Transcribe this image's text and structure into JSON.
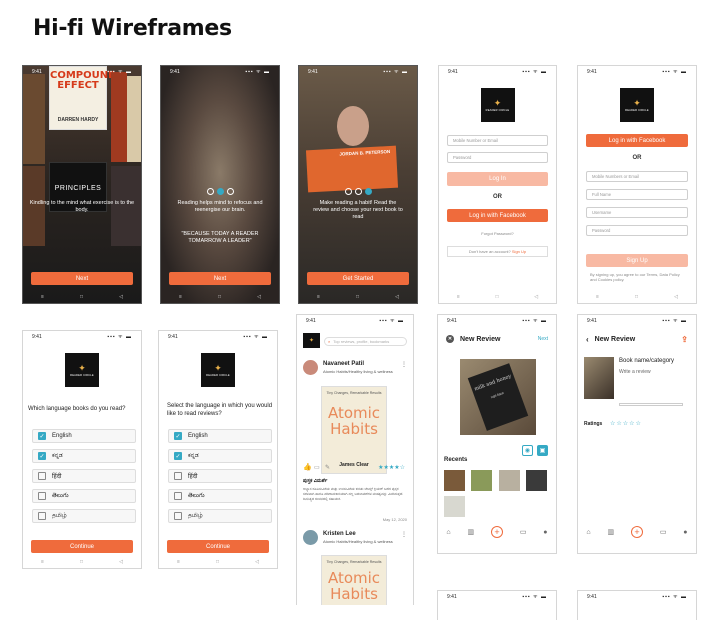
{
  "page_title": "Hi-fi Wireframes",
  "status_time": "9:41",
  "status_icons": "▪▪▪ ᯤ ▬",
  "nav_icons": [
    "≡",
    "□",
    "◁"
  ],
  "screens": {
    "onboard1": {
      "text": "Kindling to the mind what exercise is to the body.",
      "button": "Next",
      "book_title_1": "COMPOUND EFFECT",
      "book_author_1": "DARREN HARDY",
      "book_title_2": "PRINCIPLES"
    },
    "onboard2": {
      "text": "Reading helps mind to refocus and reenergise our brain.",
      "quote": "\"BECAUSE TODAY A READER TOMARROW A LEADER\"",
      "button": "Next"
    },
    "onboard3": {
      "text": "Make reading a habit! Read the review and choose your next book to read",
      "book_author": "JORDAN B. PETERSON",
      "button": "Get Started"
    },
    "login": {
      "logo_text": "READER CIRCLE",
      "mobile_placeholder": "Mobile Number or Email",
      "password_placeholder": "Password",
      "login_button": "Log In",
      "or": "OR",
      "facebook_button": "Log in with Facebook",
      "forgot": "Forgot Password?",
      "no_account": "Don't have an account?",
      "signup_link": "Sign Up"
    },
    "signup": {
      "logo_text": "READER CIRCLE",
      "facebook_button": "Log in with Facebook",
      "or": "OR",
      "mobile_placeholder": "Mobile Numbers or Email",
      "fullname_placeholder": "Full Name",
      "username_placeholder": "Username",
      "password_placeholder": "Password",
      "signup_button": "Sign Up",
      "terms": "By signing up, you agree to our Terms, Data Policy and Cookies policy."
    },
    "lang_read": {
      "logo_text": "READER CIRCLE",
      "question": "Which language books do you read?",
      "options": [
        {
          "label": "English",
          "checked": true
        },
        {
          "label": "ಕನ್ನಡ",
          "checked": true
        },
        {
          "label": "हिंदी",
          "checked": false
        },
        {
          "label": "తెలుగు",
          "checked": false
        },
        {
          "label": "தமிழ்",
          "checked": false
        }
      ],
      "button": "Continue"
    },
    "lang_review": {
      "logo_text": "READER CIRCLE",
      "question": "Select the language in which you would like to read reviews?",
      "options": [
        {
          "label": "English",
          "checked": true
        },
        {
          "label": "ಕನ್ನಡ",
          "checked": true
        },
        {
          "label": "हिंदी",
          "checked": false
        },
        {
          "label": "తెలుగు",
          "checked": false
        },
        {
          "label": "தமிழ்",
          "checked": false
        }
      ],
      "button": "Continue"
    },
    "feed": {
      "search_placeholder": "Top reviews, profile, bookmarks",
      "post1": {
        "name": "Navaneet Patil",
        "sub": "Atomic Habits/Healthy living & wellness",
        "book_line": "Tiny Changes, Remarkable Results",
        "book_title": "Atomic Habits",
        "book_author": "James Clear",
        "stars": "★★★★☆",
        "kn_title": "ಪುಸ್ತಕ ವಿಮರ್ಶೆ",
        "kn_body": "ಅಭ್ಯಾಸ ರೂಪಿಸುವಿಕೆಯ ಮತ್ತು ಉಳಿಸುವಿಕೆಯ ಕುರಿತು ಜೇಮ್ಸ್ ಕ್ಲಿಯರ್ ಬರೆದ ಪುಸ್ತಕ ಸರಳವಾಗಿ ಹಾಗೂ ಪರಿಣಾಮಕಾರಿಯಾಗಿ ಸಣ್ಣ ಬದಲಾವಣೆಗಳ ಮಹತ್ವವನ್ನು ವಿವರಿಸುತ್ತದೆ. ದಿನನಿತ್ಯದ ಜೀವನದಲ್ಲಿ ಸಹಾಯಕ.",
        "date": "May 12, 2020"
      },
      "post2": {
        "name": "Kristen Lee",
        "sub": "Atomic Habits/Healthy living & wellness",
        "book_line": "Tiny Changes, Remarkable Results",
        "book_title": "Atomic Habits"
      }
    },
    "new_review": {
      "title": "New Review",
      "next": "Next",
      "recents": "Recents",
      "book_text": "milk and honey",
      "book_author": "rupi kaur"
    },
    "new_review2": {
      "title": "New Review",
      "book_name": "Book name/category",
      "write": "Write a review",
      "ratings": "Ratings",
      "stars": "☆☆☆☆☆"
    }
  }
}
